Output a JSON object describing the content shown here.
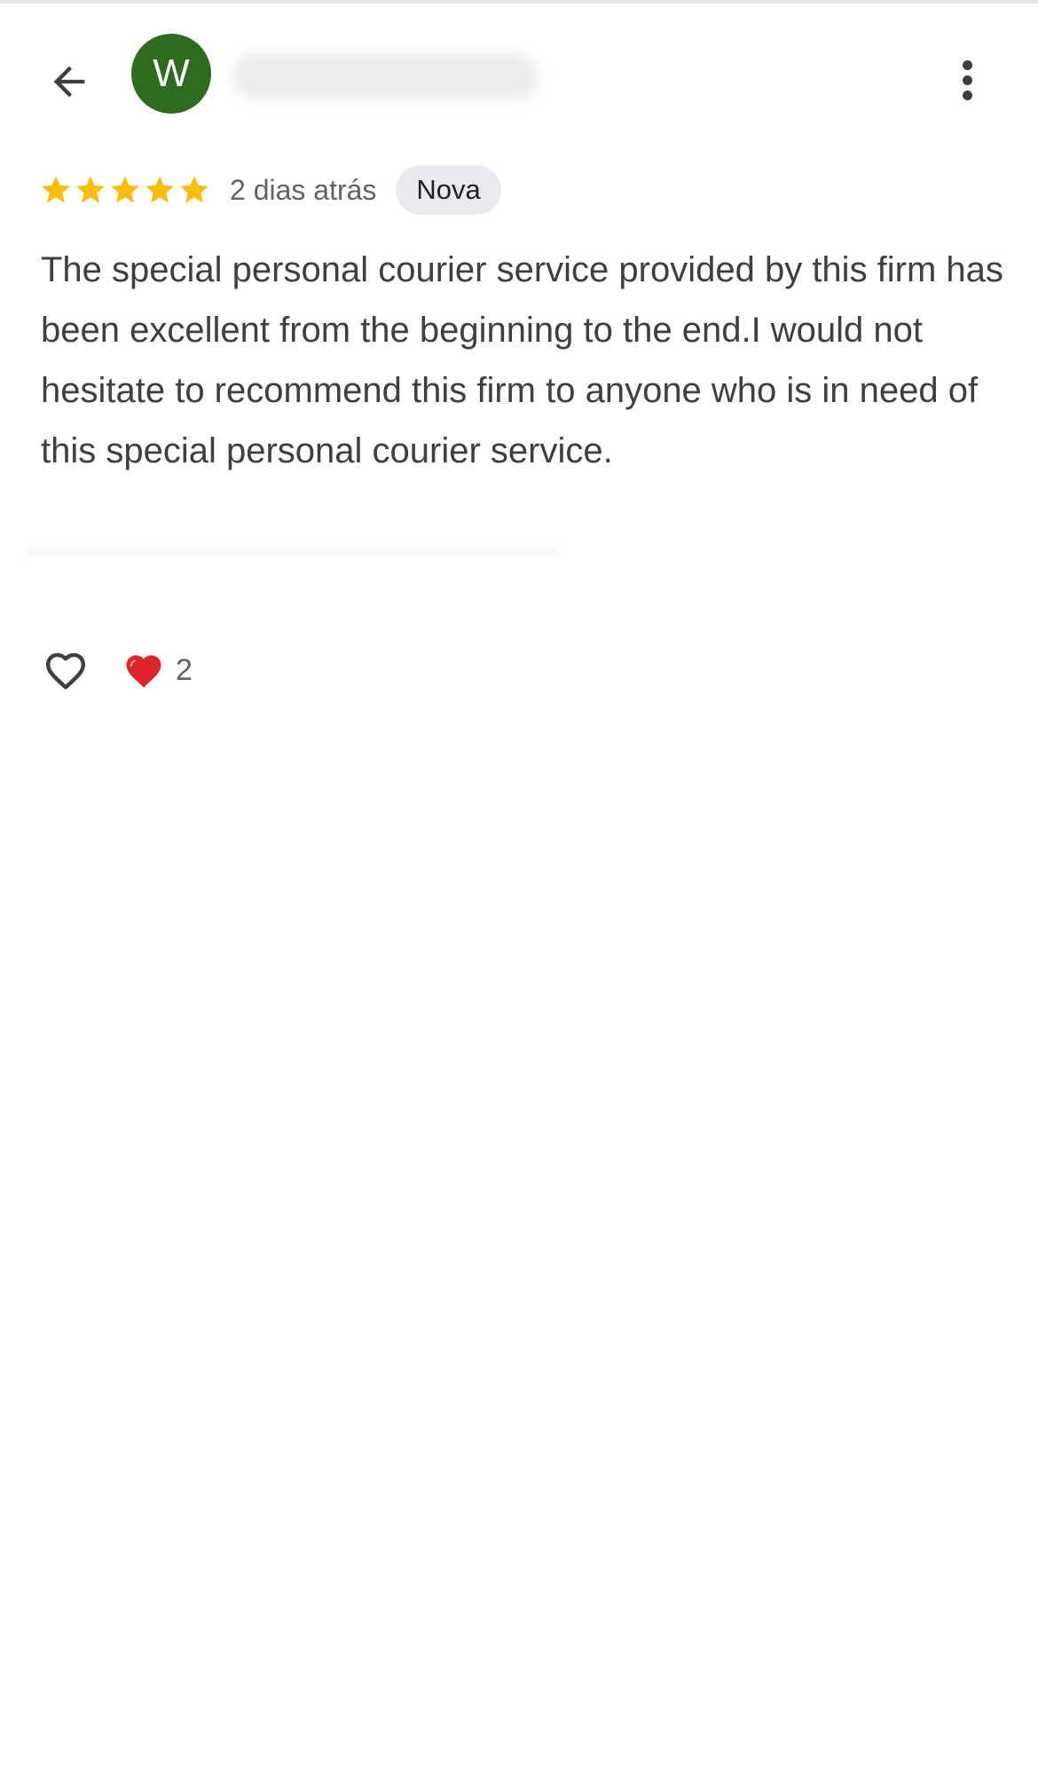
{
  "header": {
    "avatar_letter": "W",
    "avatar_color": "#2e6b1f"
  },
  "review": {
    "rating": 5,
    "rating_max": 5,
    "date": "2 dias atrás",
    "badge": "Nova",
    "text": "The special personal courier service provided by this firm has been excellent from the beginning to the end.I would not hesitate to recommend this firm to anyone who is in need of this special personal courier service.",
    "star_color": "#fbbc04"
  },
  "actions": {
    "like_icon": "heart-outline-icon",
    "reaction_icon": "red-heart-icon",
    "reaction_count": "2",
    "reaction_color": "#e0242b"
  }
}
